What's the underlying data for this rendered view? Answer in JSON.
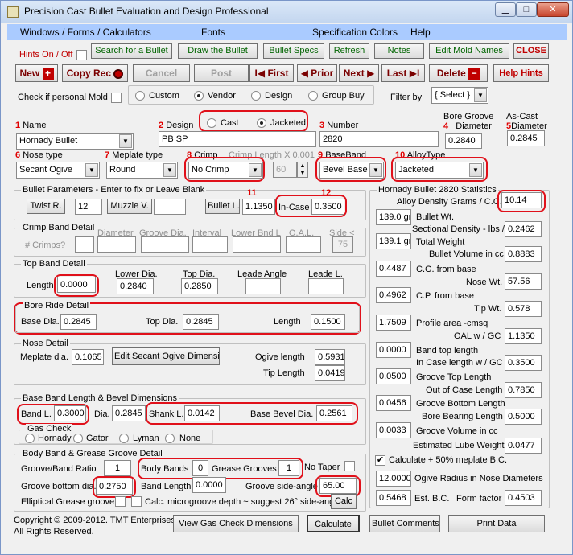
{
  "window": {
    "title": "Precision Cast Bullet Evaluation and Design Professional",
    "min": "▁",
    "max": "□",
    "close": "✕"
  },
  "menu": {
    "m1": "Windows / Forms / Calculators",
    "m2": "Fonts",
    "m3": "Specification Colors",
    "m4": "Help"
  },
  "toolbar": {
    "hints_onoff": "Hints On / Off",
    "search": "Search for a Bullet",
    "draw": "Draw the Bullet",
    "specs": "Bullet Specs",
    "refresh": "Refresh",
    "notes": "Notes",
    "edit_mold": "Edit Mold Names",
    "close": "CLOSE",
    "new": "New",
    "copy": "Copy Rec",
    "cancel": "Cancel",
    "post": "Post",
    "first": "First",
    "prior": "Prior",
    "next": "Next",
    "last": "Last",
    "delete": "Delete",
    "help_hints": "Help Hints",
    "personal_mold": "Check if personal Mold",
    "custom": "Custom",
    "vendor": "Vendor",
    "design": "Design",
    "group_buy": "Group Buy",
    "filter_by": "Filter by",
    "filter_value": "{ Select }"
  },
  "fields": {
    "n1": "1",
    "name_label": "Name",
    "name_value": "Hornady Bullet",
    "n2": "2",
    "design_label": "Design",
    "cast": "Cast",
    "jacketed": "Jacketed",
    "design_value": "PB SP",
    "n3": "3",
    "number_label": "Number",
    "number_value": "2820",
    "n4": "4",
    "bore_groove_label1": "Bore Groove",
    "bore_groove_label2": "Diameter",
    "bore_groove_value": "0.2840",
    "n5": "5",
    "as_cast_label1": "As-Cast",
    "as_cast_label2": "Diameter",
    "as_cast_value": "0.2845",
    "n6": "6",
    "nose_type_label": "Nose type",
    "nose_type_value": "Secant Ogive",
    "n7": "7",
    "meplate_type_label": "Meplate type",
    "meplate_type_value": "Round",
    "n8": "8",
    "crimp_label": "Crimp",
    "crimp_value": "No Crimp",
    "crimp_length_label": "Crimp Length X 0.001",
    "crimp_length_value": "60",
    "n9": "9",
    "baseband_label": "BaseBand",
    "baseband_value": "Bevel Base",
    "n10": "10",
    "alloy_label": "AlloyType",
    "alloy_value": "Jacketed"
  },
  "bullet_params": {
    "caption": "Bullet Parameters - Enter to fix or Leave Blank",
    "twist_btn": "Twist R.",
    "twist_value": "12",
    "muzzle_btn": "Muzzle V.",
    "muzzle_value": "",
    "n11": "11",
    "bullet_l_btn": "Bullet L.",
    "bullet_l_value": "1.1350",
    "n12": "12",
    "incase_label": "In-Case",
    "incase_value": "0.3500"
  },
  "crimp_band": {
    "caption": "Crimp Band Detail",
    "crimps": "# Crimps?",
    "diameter": "Diameter",
    "groove_dia": "Groove Dia.",
    "interval": "Interval",
    "lower_bnd": "Lower Bnd L",
    "oal": "O.A.L.",
    "side": "Side <",
    "side_value": "75"
  },
  "top_band": {
    "caption": "Top Band Detail",
    "length_label": "Length",
    "length_value": "0.0000",
    "lower_dia_label": "Lower Dia.",
    "lower_dia_value": "0.2840",
    "top_dia_label": "Top Dia.",
    "top_dia_value": "0.2850",
    "leade_angle_label": "Leade Angle",
    "leade_angle_value": "",
    "leade_l_label": "Leade L.",
    "leade_l_value": ""
  },
  "bore_ride": {
    "caption": "Bore Ride Detail",
    "base_dia_label": "Base Dia.",
    "base_dia_value": "0.2845",
    "top_dia_label": "Top Dia.",
    "top_dia_value": "0.2845",
    "length_label": "Length",
    "length_value": "0.1500"
  },
  "nose": {
    "caption": "Nose Detail",
    "meplate_label": "Meplate dia.",
    "meplate_value": "0.1065",
    "edit_btn": "Edit Secant Ogive Dimensions",
    "ogive_label": "Ogive length",
    "ogive_value": "0.5931",
    "tip_label": "Tip Length",
    "tip_value": "0.0419"
  },
  "base_band": {
    "caption": "Base Band Length & Bevel Dimensions",
    "band_l_label": "Band L.",
    "band_l_value": "0.3000",
    "dia_label": "Dia.",
    "dia_value": "0.2845",
    "shank_label": "Shank L.",
    "shank_value": "0.0142",
    "bevel_label": "Base Bevel Dia.",
    "bevel_value": "0.2561",
    "gas_caption": "Gas Check",
    "hornady": "Hornady",
    "gator": "Gator",
    "lyman": "Lyman",
    "none": "None"
  },
  "body_band": {
    "caption": "Body Band & Grease Groove Detail",
    "ratio_label": "Groove/Band Ratio",
    "ratio_value": "1",
    "body_bands_label": "Body Bands",
    "body_bands_value": "0",
    "grease_label": "Grease Grooves",
    "grease_value": "1",
    "no_taper": "No Taper",
    "groove_bottom_label": "Groove bottom dia.",
    "groove_bottom_value": "0.2750",
    "band_length_label": "Band Length",
    "band_length_value": "0.0000",
    "side_angle_label": "Groove side-angle",
    "side_angle_value": "65.00",
    "elliptical": "Elliptical Grease groove",
    "calc_micro": "Calc. microgroove depth ~ suggest 26° side-angle>",
    "calc_btn": "Calc"
  },
  "footer": {
    "copyright1": "Copyright © 2009-2012. TMT Enterprises.",
    "copyright2": "All Rights Reserved.",
    "gas_check_btn": "View Gas Check Dimensions",
    "calculate_btn": "Calculate",
    "comments_btn": "Bullet Comments",
    "print_btn": "Print Data"
  },
  "stats": {
    "caption": "Hornady Bullet 2820 Statistics",
    "alloy_density_label": "Alloy Density Grams / C.C.",
    "alloy_density_value": "10.14",
    "bullet_wt_value": "139.0 gr",
    "bullet_wt_label": "Bullet Wt.",
    "sectional_label": "Sectional Density - lbs / sq in",
    "sectional_value": "0.2462",
    "total_wt_value": "139.1 gr",
    "total_wt_label": "Total  Weight",
    "volume_label": "Bullet Volume in cc",
    "volume_value": "0.8883",
    "cg_value": "0.4487",
    "cg_label": "C.G. from base",
    "nose_wt_label": "Nose Wt.",
    "nose_wt_value": "57.56",
    "cp_value": "0.4962",
    "cp_label": "C.P. from base",
    "tip_wt_label": "Tip Wt.",
    "tip_wt_value": "0.578",
    "profile_value": "1.7509",
    "profile_label": "Profile area -cmsq",
    "oal_label": "OAL w / GC",
    "oal_value": "1.1350",
    "top_len_value": "0.0000",
    "top_len_label": "Band top length",
    "incase_gc_label": "In Case length w / GC",
    "incase_gc_value": "0.3500",
    "groove_top_value": "0.0500",
    "groove_top_label": "Groove Top Length",
    "out_case_label": "Out of Case Length",
    "out_case_value": "0.7850",
    "groove_bottom_value": "0.0456",
    "groove_bottom_label": "Groove Bottom Length",
    "bearing_label": "Bore Bearing Length",
    "bearing_value": "0.5000",
    "groove_vol_value": "0.0033",
    "groove_vol_label": "Groove Volume in cc",
    "lube_label": "Estimated Lube Weight",
    "lube_value": "0.0477",
    "calc_meplate": "Calculate + 50% meplate B.C.",
    "ogive_radius_value": "12.0000",
    "ogive_radius_label": "Ogive Radius in Nose Diameters",
    "est_bc_value": "0.5468",
    "est_bc_label": "Est. B.C.",
    "form_factor_label": "Form factor",
    "form_factor_value": "0.4503"
  },
  "colors": {
    "menubar": "#aacbff",
    "red_number": "#e00000",
    "ring": "#e0101a",
    "green_text": "#006400"
  }
}
